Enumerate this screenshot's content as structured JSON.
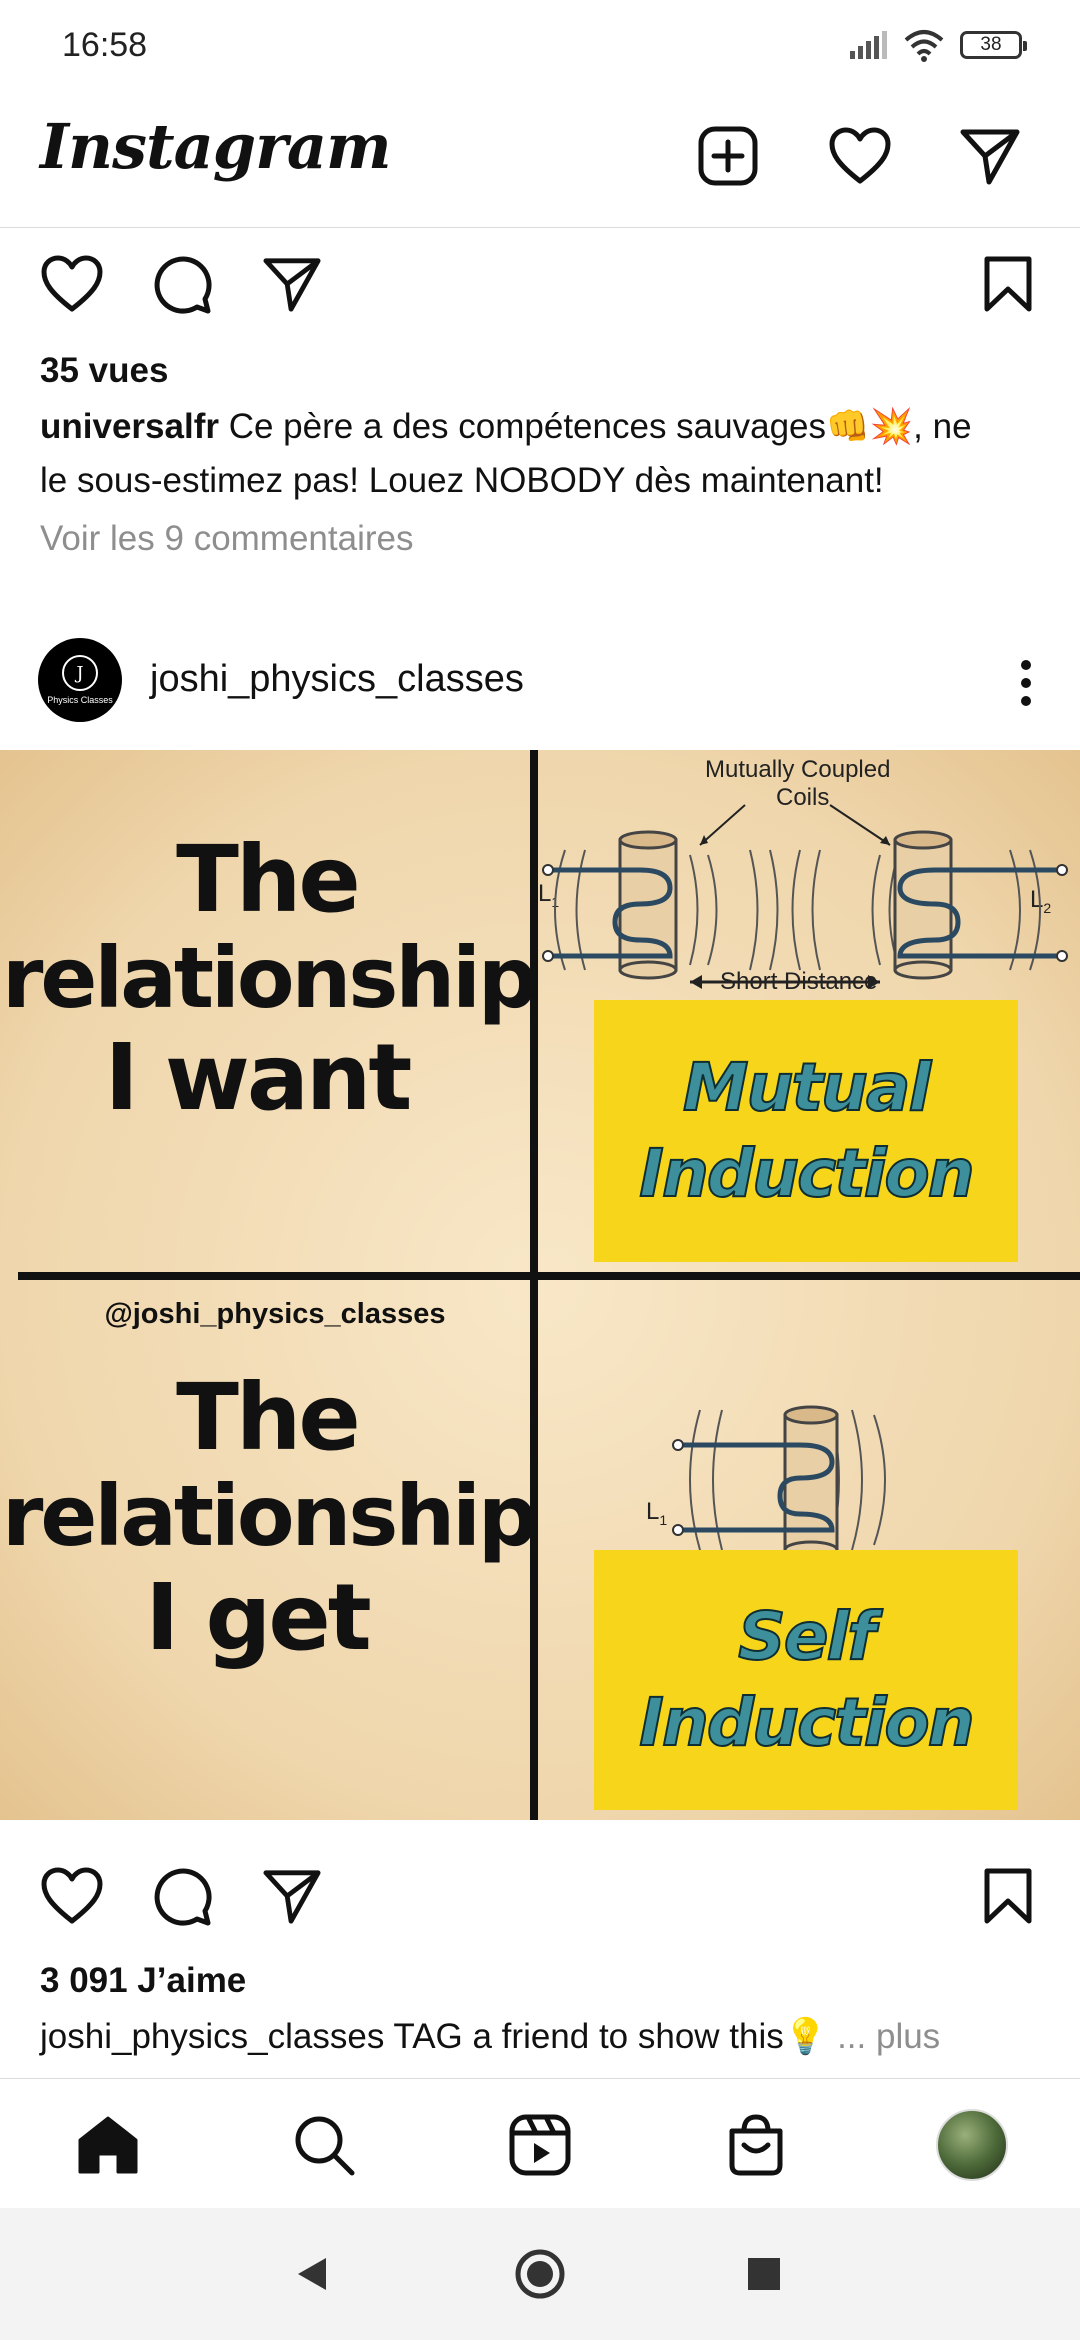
{
  "status": {
    "time": "16:58",
    "battery": "38"
  },
  "header": {
    "logo": "Instagram",
    "icons": [
      "new-post-icon",
      "activity-heart-icon",
      "direct-message-icon"
    ]
  },
  "prev_post": {
    "views": "35 vues",
    "username": "universalfr",
    "caption_line1": " Ce père a des compétences sauvages👊💥, ne",
    "caption_line2": "le sous-estimez pas! Louez NOBODY dès maintenant!",
    "comments_link": "Voir les 9 commentaires"
  },
  "post": {
    "username": "joshi_physics_classes",
    "avatar_text": "Physics Classes",
    "image": {
      "the1": "The",
      "relationship1": "relationship",
      "want": "I want",
      "watermark": "@joshi_physics_classes",
      "the2": "The",
      "relationship2": "relationship",
      "get": "I get",
      "coupled_label_1": "Mutually Coupled",
      "coupled_label_2": "Coils",
      "short_distance": "Short Distance",
      "l1_top": "L",
      "l1_top_sub": "1",
      "l2": "L",
      "l2_sub": "2",
      "l1_bottom": "L",
      "l1_bottom_sub": "1",
      "mutual": "Mutual",
      "induction1": "Induction",
      "self": "Self",
      "induction2": "Induction"
    },
    "likes": "3 091 J’aime",
    "caption_text": " TAG a friend to show this💡",
    "more": " ... plus"
  },
  "nav": {
    "items": [
      "home-icon",
      "search-icon",
      "reels-icon",
      "shop-icon",
      "profile-avatar"
    ]
  }
}
